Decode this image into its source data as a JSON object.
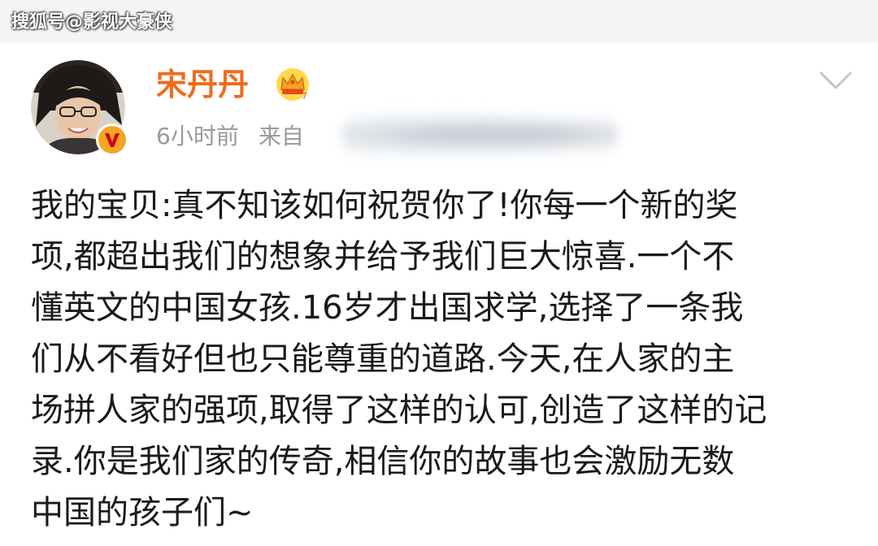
{
  "watermark": "搜狐号@影视大豪侠",
  "user": {
    "name": "宋丹丹",
    "time": "6小时前",
    "source_prefix": "来自"
  },
  "post": {
    "lines": [
      "我的宝贝:真不知该如何祝贺你了!你每一个新的奖",
      "项,都超出我们的想象并给予我们巨大惊喜.一个不",
      "懂英文的中国女孩.16岁才出国求学,选择了一条我",
      "们从不看好但也只能尊重的道路.今天,在人家的主",
      "场拼人家的强项,取得了这样的认可,创造了这样的记",
      "录.你是我们家的传奇,相信你的故事也会激励无数",
      "中国的孩子们~"
    ]
  },
  "colors": {
    "username": "#f06b1e",
    "meta": "#9a9a9a",
    "body_text": "#1a1a1a",
    "verified_badge": "#f5a623"
  },
  "icons": {
    "avatar": "avatar",
    "verified": "verified-v-badge-icon",
    "crown": "crown-icon",
    "chevron": "chevron-down-icon"
  }
}
